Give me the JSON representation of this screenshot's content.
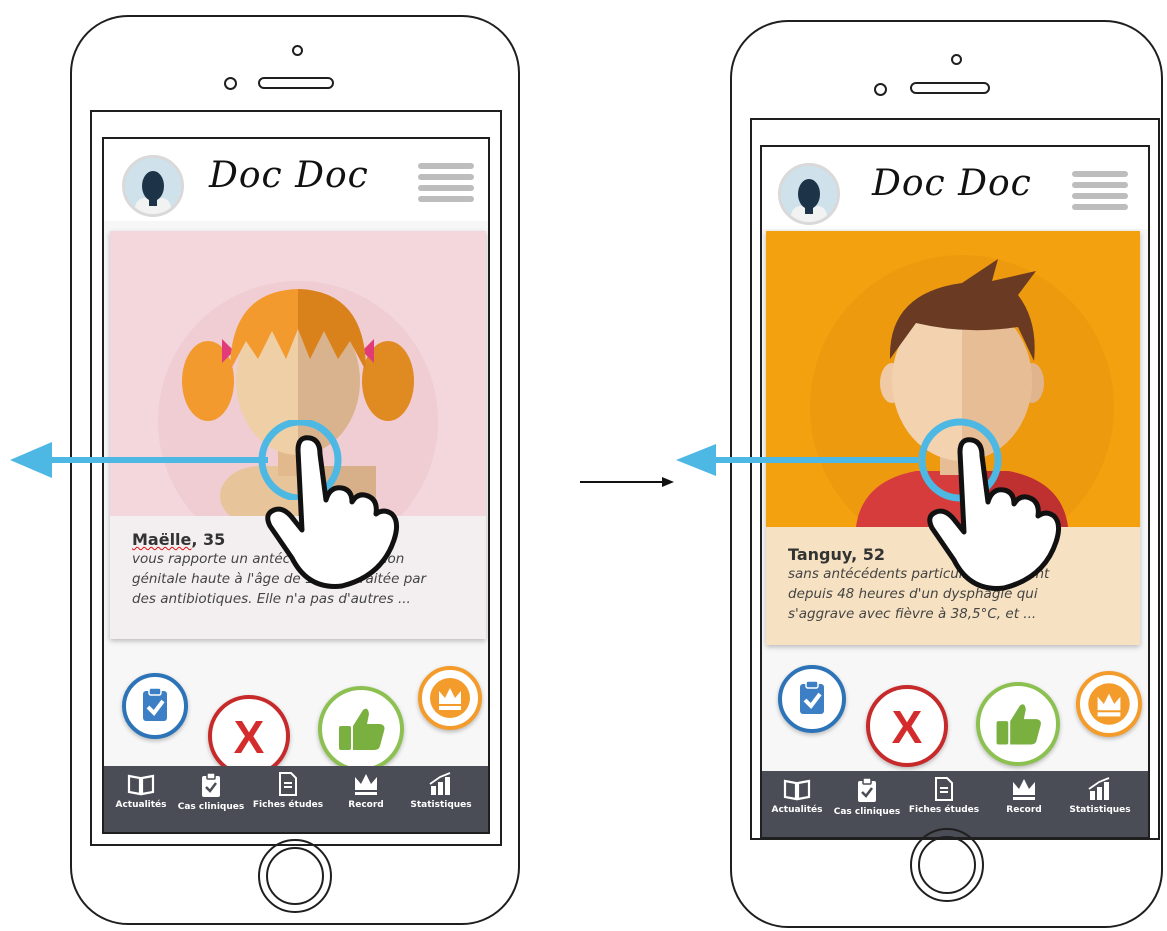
{
  "app": {
    "logo": "Doc Doc"
  },
  "screens": [
    {
      "patient": {
        "name": "Maëlle",
        "age_suffix": ", 35",
        "desc_lines": [
          "vous rapporte un antécédent d'infection",
          "génitale haute à l'âge de 18 ans traitée par",
          "des antibiotiques. Elle n'a pas d'autres ..."
        ]
      },
      "card_bg": "#f3d7dc"
    },
    {
      "patient": {
        "name": "Tanguy",
        "age_suffix": ", 52",
        "desc_lines": [
          "sans antécédents particuliers se plaint",
          "depuis 48 heures d'un dysphagie qui",
          "s'aggrave avec fièvre à 38,5°C, et ..."
        ]
      },
      "card_bg": "#f4a10f"
    }
  ],
  "nav": {
    "items": [
      "Actualités",
      "Cas cliniques",
      "Fiches études",
      "Record",
      "Statistiques"
    ]
  },
  "actions": {
    "names": [
      "clinical-cases-action",
      "reject-action",
      "like-action",
      "record-action"
    ],
    "reject_glyph": "X"
  },
  "colors": {
    "swipe_arrow": "#4cb8e3",
    "nav_bg": "#4a4d55",
    "reject": "#c62a2a",
    "like": "#8cc152",
    "record": "#f39c2c",
    "cases": "#2c73b8"
  },
  "icons": [
    "avatar-icon",
    "menu-icon",
    "book-icon",
    "clipboard-check-icon",
    "document-icon",
    "crown-icon",
    "bar-chart-icon",
    "hand-pointer-icon",
    "swipe-left-arrow-icon",
    "right-arrow-icon"
  ]
}
